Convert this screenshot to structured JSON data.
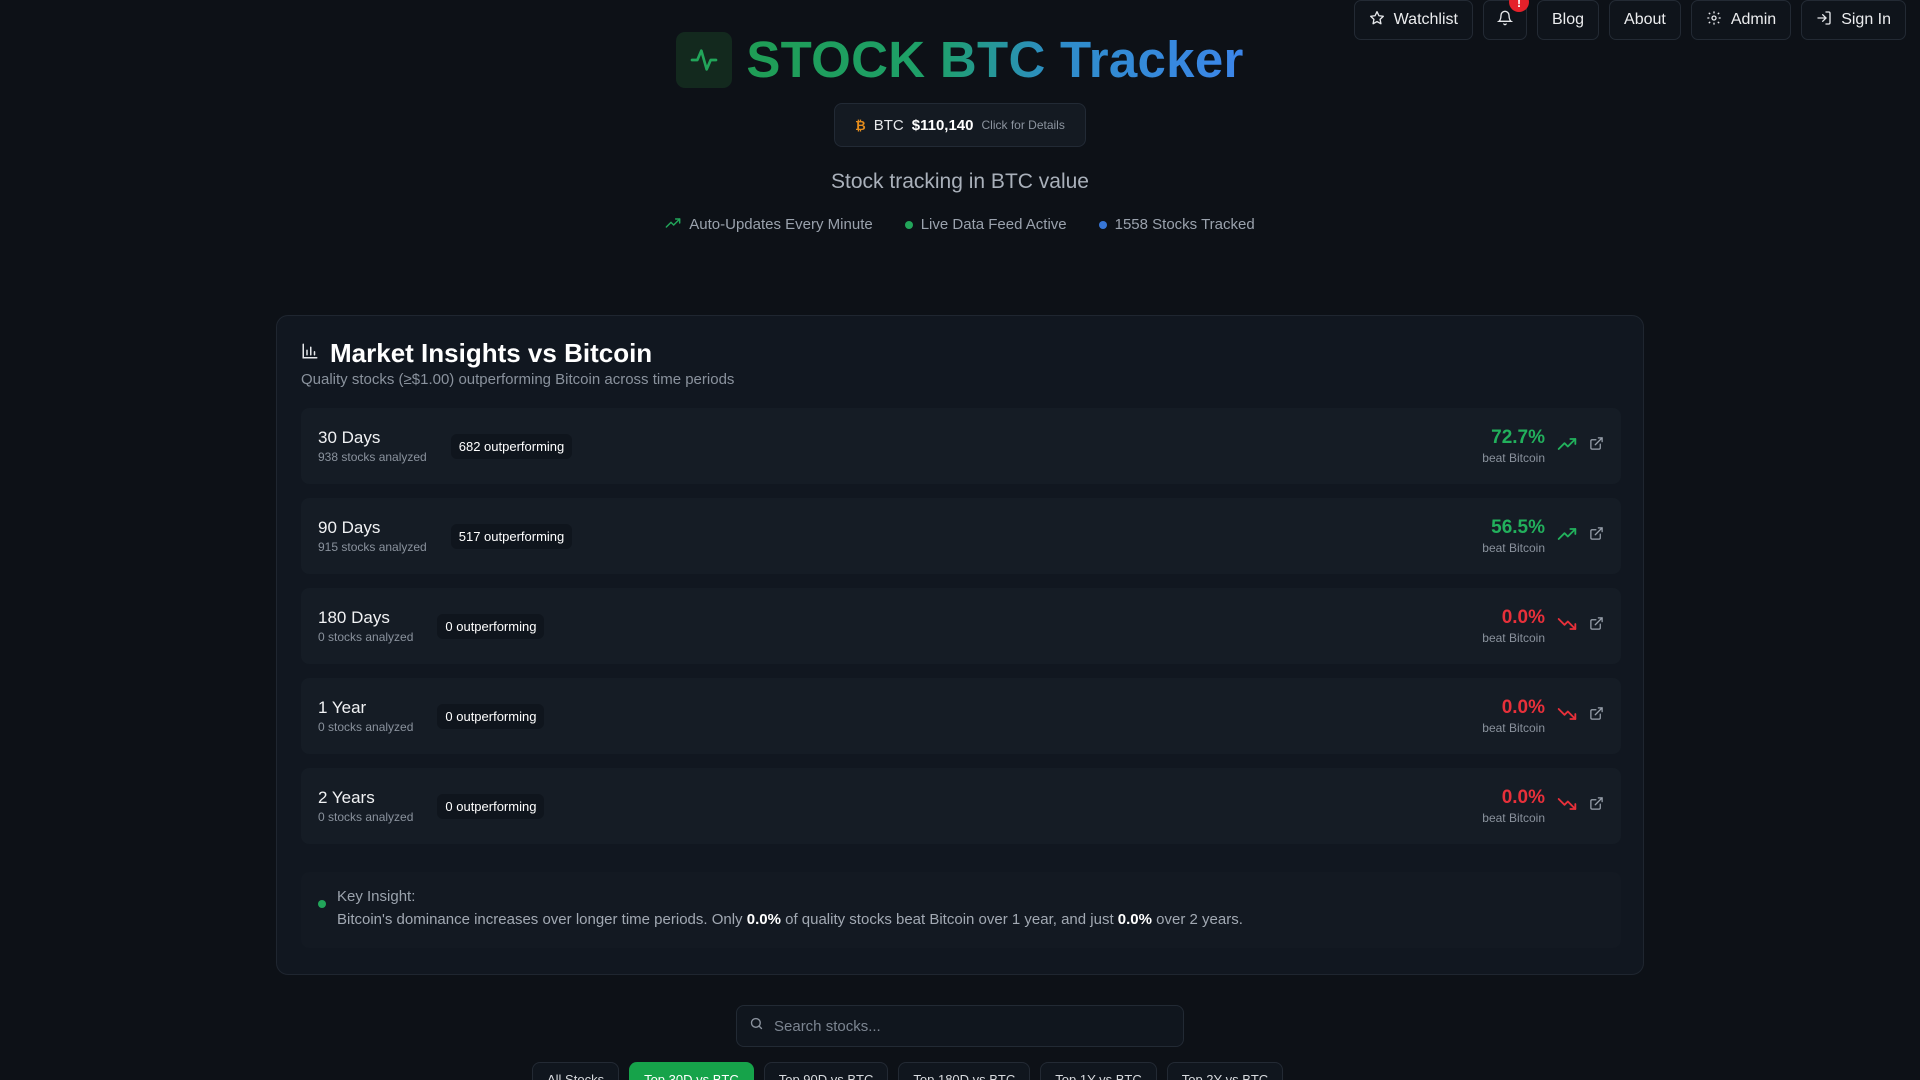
{
  "nav": {
    "watchlist": "Watchlist",
    "notifications_badge": "!",
    "blog": "Blog",
    "about": "About",
    "admin": "Admin",
    "sign_in": "Sign In"
  },
  "header": {
    "title": "STOCK BTC Tracker",
    "btc": {
      "symbol": "₿",
      "label": "BTC",
      "price": "$110,140",
      "hint": "Click for Details"
    },
    "subtitle": "Stock tracking in BTC value",
    "status": [
      {
        "text": "Auto-Updates Every Minute",
        "icon": "trending-up-icon"
      },
      {
        "text": "Live Data Feed Active",
        "color": "#22a55a"
      },
      {
        "text": "1558 Stocks Tracked",
        "color": "#3776d6"
      }
    ]
  },
  "insights": {
    "title": "Market Insights vs Bitcoin",
    "subtitle": "Quality stocks (≥$1.00) outperforming Bitcoin across time periods",
    "periods": [
      {
        "name": "30 Days",
        "analyzed": "938 stocks analyzed",
        "outperforming": "682 outperforming",
        "pct": "72.7%",
        "beat": "beat Bitcoin",
        "trend": "up"
      },
      {
        "name": "90 Days",
        "analyzed": "915 stocks analyzed",
        "outperforming": "517 outperforming",
        "pct": "56.5%",
        "beat": "beat Bitcoin",
        "trend": "up"
      },
      {
        "name": "180 Days",
        "analyzed": "0 stocks analyzed",
        "outperforming": "0 outperforming",
        "pct": "0.0%",
        "beat": "beat Bitcoin",
        "trend": "down"
      },
      {
        "name": "1 Year",
        "analyzed": "0 stocks analyzed",
        "outperforming": "0 outperforming",
        "pct": "0.0%",
        "beat": "beat Bitcoin",
        "trend": "down"
      },
      {
        "name": "2 Years",
        "analyzed": "0 stocks analyzed",
        "outperforming": "0 outperforming",
        "pct": "0.0%",
        "beat": "beat Bitcoin",
        "trend": "down"
      }
    ],
    "key_insight": {
      "title": "Key Insight:",
      "text_1": "Bitcoin's dominance increases over longer time periods. Only ",
      "value_1": "0.0%",
      "text_2": " of quality stocks beat Bitcoin over 1 year, and just ",
      "value_2": "0.0%",
      "text_3": " over 2 years."
    }
  },
  "search": {
    "placeholder": "Search stocks..."
  },
  "tabs": [
    {
      "label": "All Stocks",
      "active": false
    },
    {
      "label": "Top 30D vs BTC",
      "active": true
    },
    {
      "label": "Top 90D vs BTC",
      "active": false
    },
    {
      "label": "Top 180D vs BTC",
      "active": false
    },
    {
      "label": "Top 1Y vs BTC",
      "active": false
    },
    {
      "label": "Top 2Y vs BTC",
      "active": false
    }
  ],
  "colors": {
    "positive": "#22b05c",
    "negative": "#e8303a",
    "accent_green": "#16a34a",
    "btc_orange": "#e58c1c"
  }
}
